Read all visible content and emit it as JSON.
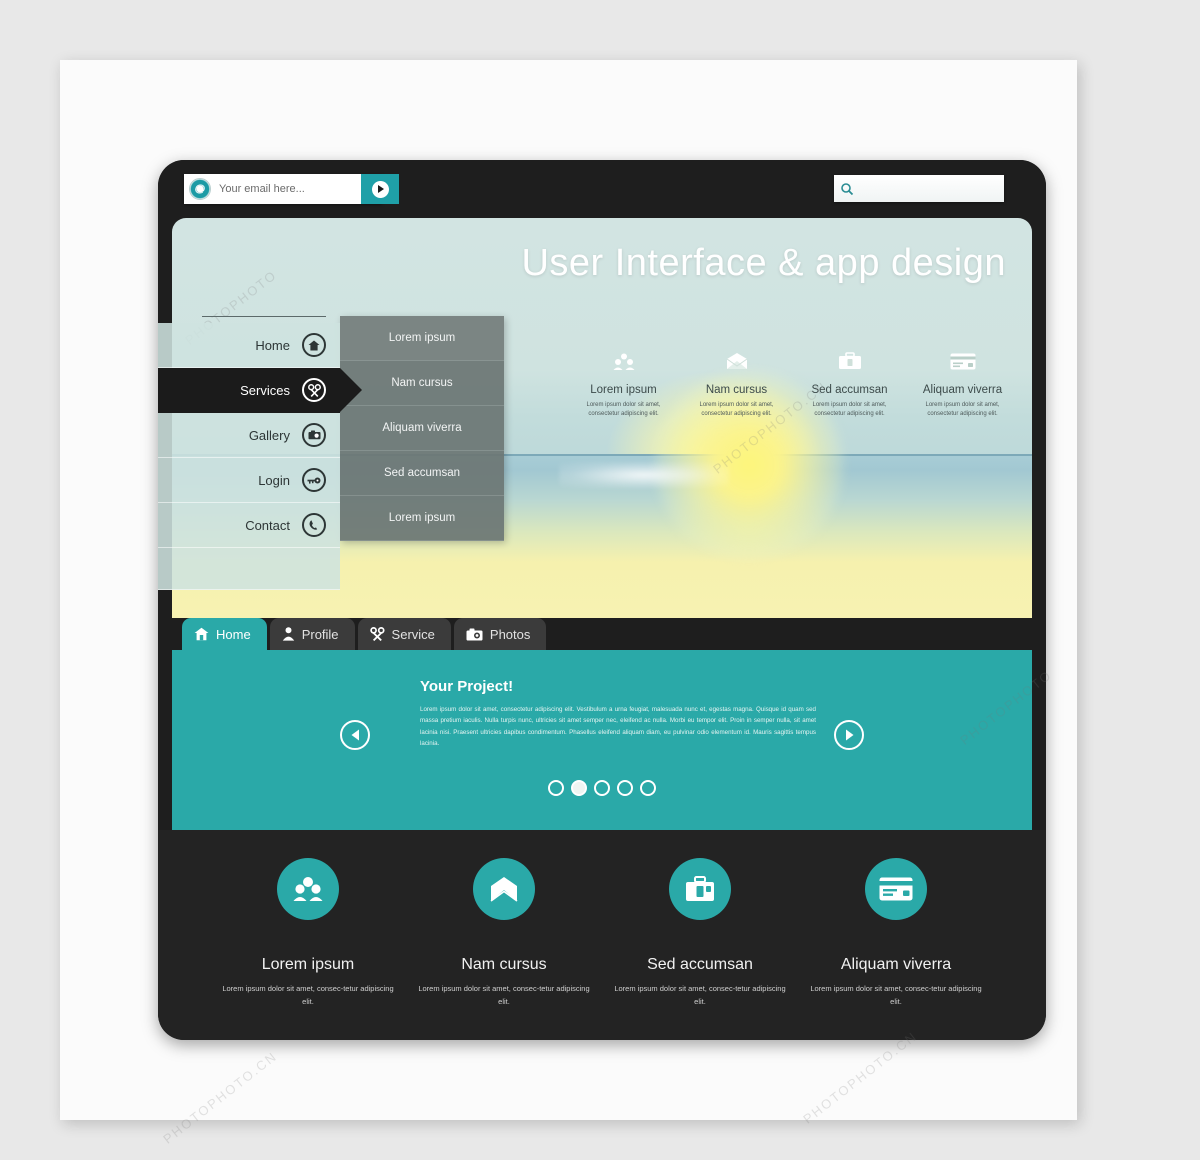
{
  "topbar": {
    "email_placeholder": "Your email here...",
    "email_value": "",
    "at_icon": "at-icon",
    "go_icon": "play-icon",
    "search_placeholder": "",
    "search_value": "",
    "search_icon": "search-icon"
  },
  "hero": {
    "title": "User Interface & app design",
    "features": [
      {
        "icon": "people-icon",
        "title": "Lorem ipsum",
        "desc": "Lorem ipsum dolor sit amet, consectetur adipiscing elit."
      },
      {
        "icon": "envelope-icon",
        "title": "Nam cursus",
        "desc": "Lorem ipsum dolor sit amet, consectetur adipiscing elit."
      },
      {
        "icon": "briefcase-icon",
        "title": "Sed accumsan",
        "desc": "Lorem ipsum dolor sit amet, consectetur adipiscing elit."
      },
      {
        "icon": "credit-card-icon",
        "title": "Aliquam viverra",
        "desc": "Lorem ipsum dolor sit amet, consectetur adipiscing elit."
      }
    ]
  },
  "sidebar": {
    "items": [
      {
        "label": "Home",
        "icon": "home-icon",
        "active": false
      },
      {
        "label": "Services",
        "icon": "wrench-icon",
        "active": true
      },
      {
        "label": "Gallery",
        "icon": "camera-icon",
        "active": false
      },
      {
        "label": "Login",
        "icon": "key-icon",
        "active": false
      },
      {
        "label": "Contact",
        "icon": "phone-icon",
        "active": false
      }
    ]
  },
  "submenu": {
    "items": [
      {
        "label": "Lorem ipsum"
      },
      {
        "label": "Nam cursus"
      },
      {
        "label": "Aliquam viverra"
      },
      {
        "label": "Sed accumsan"
      },
      {
        "label": "Lorem ipsum"
      }
    ]
  },
  "tabs": [
    {
      "label": "Home",
      "icon": "home-icon",
      "active": true
    },
    {
      "label": "Profile",
      "icon": "person-icon",
      "active": false
    },
    {
      "label": "Service",
      "icon": "wrench-icon",
      "active": false
    },
    {
      "label": "Photos",
      "icon": "camera-icon",
      "active": false
    }
  ],
  "slider": {
    "title": "Your Project!",
    "text": "Lorem ipsum dolor sit amet, consectetur adipiscing elit. Vestibulum a urna feugiat, malesuada nunc et, egestas magna. Quisque id quam sed massa pretium iaculis. Nulla turpis nunc, ultricies sit amet semper nec, eleifend ac nulla. Morbi eu tempor elit. Proin in semper nulla, sit amet lacinia nisi. Praesent ultricies dapibus condimentum. Phasellus eleifend aliquam diam, eu pulvinar odio elementum id. Mauris sagittis tempus lacinia.",
    "prev_icon": "chevron-left-icon",
    "next_icon": "chevron-right-icon",
    "dot_count": 5,
    "active_dot": 1
  },
  "footer": {
    "columns": [
      {
        "icon": "people-icon",
        "title": "Lorem ipsum",
        "desc": "Lorem ipsum dolor sit amet, consec-tetur adipiscing elit."
      },
      {
        "icon": "envelope-icon",
        "title": "Nam cursus",
        "desc": "Lorem ipsum dolor sit amet, consec-tetur adipiscing elit."
      },
      {
        "icon": "briefcase-icon",
        "title": "Sed accumsan",
        "desc": "Lorem ipsum dolor sit amet, consec-tetur adipiscing elit."
      },
      {
        "icon": "credit-card-icon",
        "title": "Aliquam viverra",
        "desc": "Lorem ipsum dolor sit amet, consec-tetur adipiscing elit."
      }
    ]
  },
  "colors": {
    "accent_teal": "#2aa9a8",
    "frame_dark": "#1e1e1e",
    "footer_dark": "#232323",
    "nav_mint": "#cee2df",
    "submenu_gray": "#6c7674"
  },
  "watermarks": [
    "PHOTOPHOTO.CN",
    "PHOTOPHOTO",
    "PHOTOPHOTO.CN",
    "PHOTOPHOTO.CN",
    "PHOTOPHOTO"
  ]
}
